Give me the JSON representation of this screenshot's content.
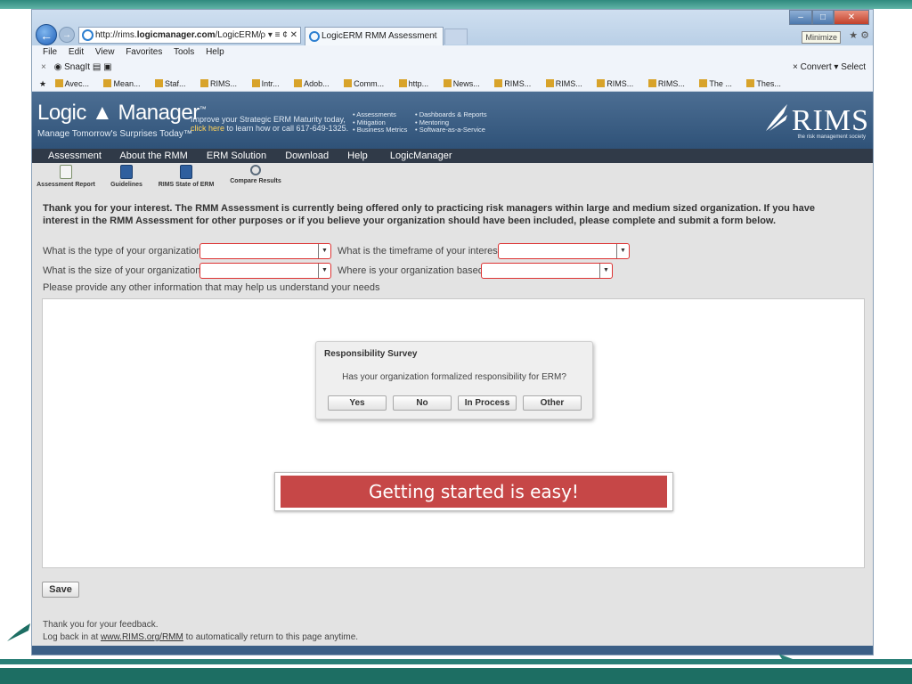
{
  "browser": {
    "url_prefix": "http://rims.",
    "url_domain": "logicmanager.com",
    "url_path": "/LogicERM/",
    "url_tools": "ρ ▾ ≡ ¢ ✕",
    "tab_title": "LogicERM RMM Assessment",
    "tab_close": "×",
    "minimize_tooltip": "Minimize",
    "menu": [
      "File",
      "Edit",
      "View",
      "Favorites",
      "Tools",
      "Help"
    ],
    "snagit_label": "SnagIt",
    "convert_label": "Convert",
    "select_label": "Select",
    "favorites": [
      "Avec...",
      "Mean...",
      "Staf...",
      "RIMS...",
      "Intr...",
      "Adob...",
      "Comm...",
      "http...",
      "News...",
      "RIMS...",
      "RIMS...",
      "RIMS...",
      "RIMS...",
      "The ...",
      "Thes..."
    ]
  },
  "banner": {
    "logo": "Logic ▲ Manager",
    "logo_tm": "™",
    "tagline": "Manage Tomorrow's Surprises Today™",
    "promo_line1": "Improve your Strategic ERM Maturity today,",
    "promo_click": "click here",
    "promo_line2": " to learn how or call 617-649-1325.",
    "features_col1": [
      "• Assessments",
      "• Mitigation",
      "• Business Metrics"
    ],
    "features_col2": [
      "• Dashboards & Reports",
      "• Mentoring",
      "• Software-as-a-Service"
    ],
    "rims_logo": "RIMS",
    "rims_sub": "the risk management society"
  },
  "nav": [
    "Assessment",
    "About the RMM",
    "ERM Solution",
    "Download",
    "Help",
    "LogicManager"
  ],
  "toolbar": [
    {
      "label": "Assessment Report",
      "icon": "report-icon"
    },
    {
      "label": "Guidelines",
      "icon": "disk-icon"
    },
    {
      "label": "RIMS State of ERM",
      "icon": "disk-icon"
    },
    {
      "label": "Compare Results",
      "icon": "magnifier-icon"
    }
  ],
  "intro": "Thank you for your interest. The RMM Assessment is currently being offered only to practicing risk managers within large and medium sized organization. If you have interest in the RMM Assessment for other purposes or if you believe your organization should have been included, please complete and submit a form below.",
  "form": {
    "q_type": "What is the type of your organization?",
    "q_timeframe": "What is the timeframe of your interest?",
    "q_size": "What is the size of your organization?",
    "q_based": "Where is your organization based?",
    "required_mark": "*",
    "other_info": "Please provide any other information that may help us understand your needs"
  },
  "survey": {
    "title": "Responsibility Survey",
    "question": "Has your organization formalized responsibility for ERM?",
    "buttons": [
      "Yes",
      "No",
      "In Process",
      "Other"
    ]
  },
  "callout": "Getting started is easy!",
  "save_label": "Save",
  "footer": {
    "thanks": "Thank you for your feedback.",
    "login_prefix": "Log back in at ",
    "login_link": "www.RIMS.org/RMM",
    "login_suffix": " to automatically return to this page anytime."
  }
}
